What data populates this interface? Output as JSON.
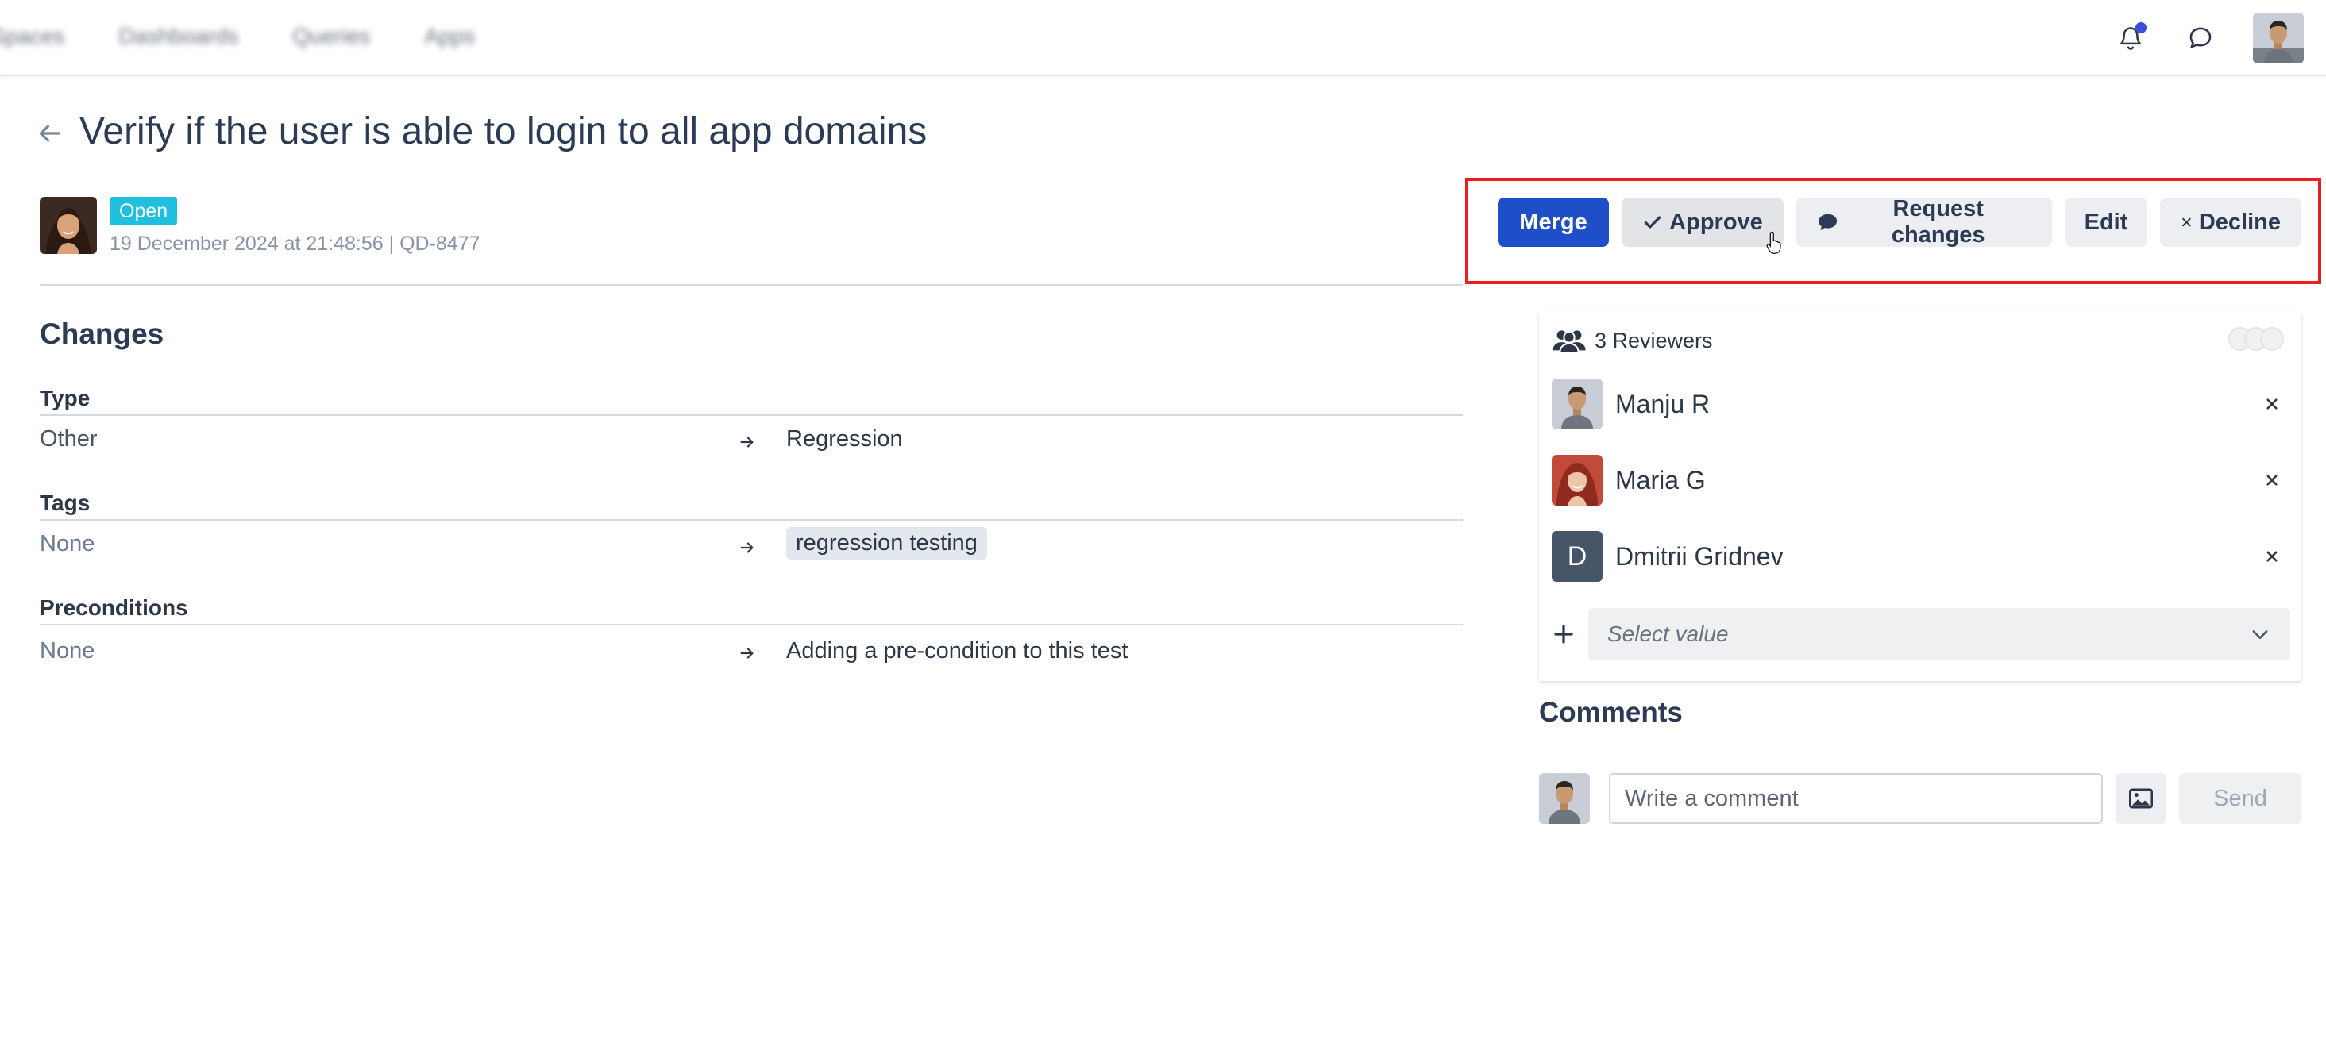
{
  "topbar": {
    "nav_items": [
      "Spaces",
      "Dashboards",
      "Queries",
      "Apps"
    ]
  },
  "page": {
    "title": "Verify if the user is able to login to all app domains"
  },
  "meta": {
    "status": "Open",
    "status_color": "#1fbfe0",
    "timestamp": "19 December 2024 at 21:48:56 | QD-8477"
  },
  "actions": {
    "merge": "Merge",
    "approve": "Approve",
    "request_changes": "Request changes",
    "edit": "Edit",
    "decline": "Decline",
    "primary_color": "#1f4fc8",
    "highlight_color": "#ee1c1c"
  },
  "changes": {
    "title": "Changes",
    "fields": [
      {
        "label": "Type",
        "old": "Other",
        "new": "Regression"
      },
      {
        "label": "Tags",
        "old": "None",
        "new": "regression testing"
      },
      {
        "label": "Preconditions",
        "old": "None",
        "new": "Adding a pre-condition to this test"
      }
    ]
  },
  "reviewers": {
    "header": "3 Reviewers",
    "list": [
      {
        "name": "Manju R"
      },
      {
        "name": "Maria G"
      },
      {
        "name": "Dmitrii Gridnev",
        "initial": "D"
      }
    ],
    "select_placeholder": "Select value"
  },
  "comments": {
    "title": "Comments",
    "placeholder": "Write a comment",
    "send": "Send"
  }
}
